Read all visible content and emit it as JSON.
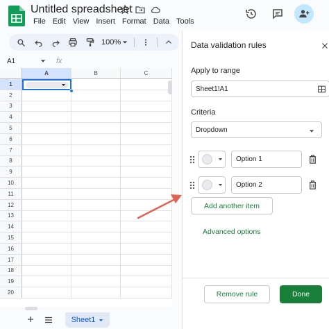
{
  "app": {
    "doc_title": "Untitled spreadsheet",
    "menu": [
      "File",
      "Edit",
      "View",
      "Insert",
      "Format",
      "Data",
      "Tools"
    ],
    "title_icons": [
      "star-icon",
      "move-to-folder-icon",
      "cloud-status-icon"
    ],
    "top_actions": [
      "history-icon",
      "comments-icon",
      "share-add-person-icon"
    ],
    "brand_color": "#0f9d58"
  },
  "toolbar": {
    "zoom": "100%",
    "icons": [
      "search-icon",
      "undo-icon",
      "redo-icon",
      "print-icon",
      "paint-format-icon",
      "zoom-caret-icon",
      "more-vert-icon",
      "collapse-up-icon"
    ]
  },
  "formula_bar": {
    "cell_ref": "A1",
    "fx": "fx"
  },
  "grid": {
    "columns": [
      "A",
      "B",
      "C"
    ],
    "rows": [
      "1",
      "2",
      "3",
      "4",
      "5",
      "6",
      "7",
      "8",
      "9",
      "10",
      "11",
      "12",
      "13",
      "14",
      "15",
      "16",
      "17",
      "18",
      "19",
      "20"
    ],
    "selected_cell": "A1",
    "selection_color": "#1a73e8"
  },
  "bottom": {
    "sheet_tab": "Sheet1"
  },
  "panel": {
    "title": "Data validation rules",
    "apply_label": "Apply to range",
    "range_value": "Sheet1!A1",
    "criteria_label": "Criteria",
    "criteria_value": "Dropdown",
    "options": [
      {
        "value": "Option 1"
      },
      {
        "value": "Option 2"
      }
    ],
    "add_item": "Add another item",
    "advanced": "Advanced options",
    "remove_rule": "Remove rule",
    "done": "Done",
    "accent_color": "#188038"
  },
  "annotation": {
    "arrow_color": "#e06155"
  }
}
